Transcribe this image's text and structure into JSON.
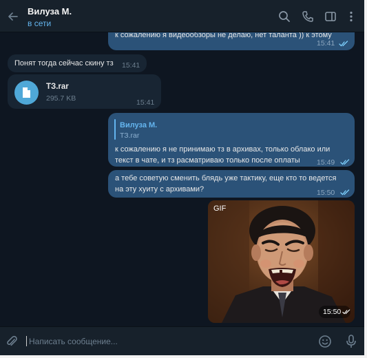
{
  "header": {
    "contact_name": "Вилуза М.",
    "status": "в сети"
  },
  "messages": [
    {
      "dir": "out",
      "text": "к сожалению я видеообзоры не делаю, нет таланта )) к этому",
      "time": "15:41",
      "read": true
    },
    {
      "dir": "in",
      "text": "Понят тогда сейчас скину тз",
      "time": "15:41"
    },
    {
      "dir": "in",
      "type": "file",
      "file_name": "ТЗ.rar",
      "file_size": "295.7 KB",
      "time": "15:41"
    },
    {
      "dir": "out",
      "reply_to": {
        "name": "Вилуза М.",
        "text": "ТЗ.rar"
      },
      "text_lines": [
        "к сожалению  я не принимаю тз в архивах, только облако или",
        "текст в чате, и тз расматриваю только после оплаты"
      ],
      "time": "15:49",
      "read": true
    },
    {
      "dir": "out",
      "text_lines": [
        "а тебе советую сменить блядь уже тактику, еще кто то ведется",
        "на эту хуиту с архивами?"
      ],
      "time": "15:50",
      "read": true
    },
    {
      "dir": "out",
      "type": "gif",
      "label": "GIF",
      "time": "15:50",
      "read": true
    }
  ],
  "composer": {
    "placeholder": "Написать сообщение..."
  },
  "icons": {
    "back": "arrow-left-icon",
    "search": "search-icon",
    "call": "phone-icon",
    "panel": "sidebar-panel-icon",
    "menu": "more-vertical-icon",
    "attach": "paperclip-icon",
    "emoji": "smile-icon",
    "mic": "microphone-icon"
  },
  "colors": {
    "background": "#0e1621",
    "header": "#17212b",
    "incoming_bubble": "#182533",
    "outgoing_bubble": "#2b5278",
    "accent": "#64b5ef"
  }
}
